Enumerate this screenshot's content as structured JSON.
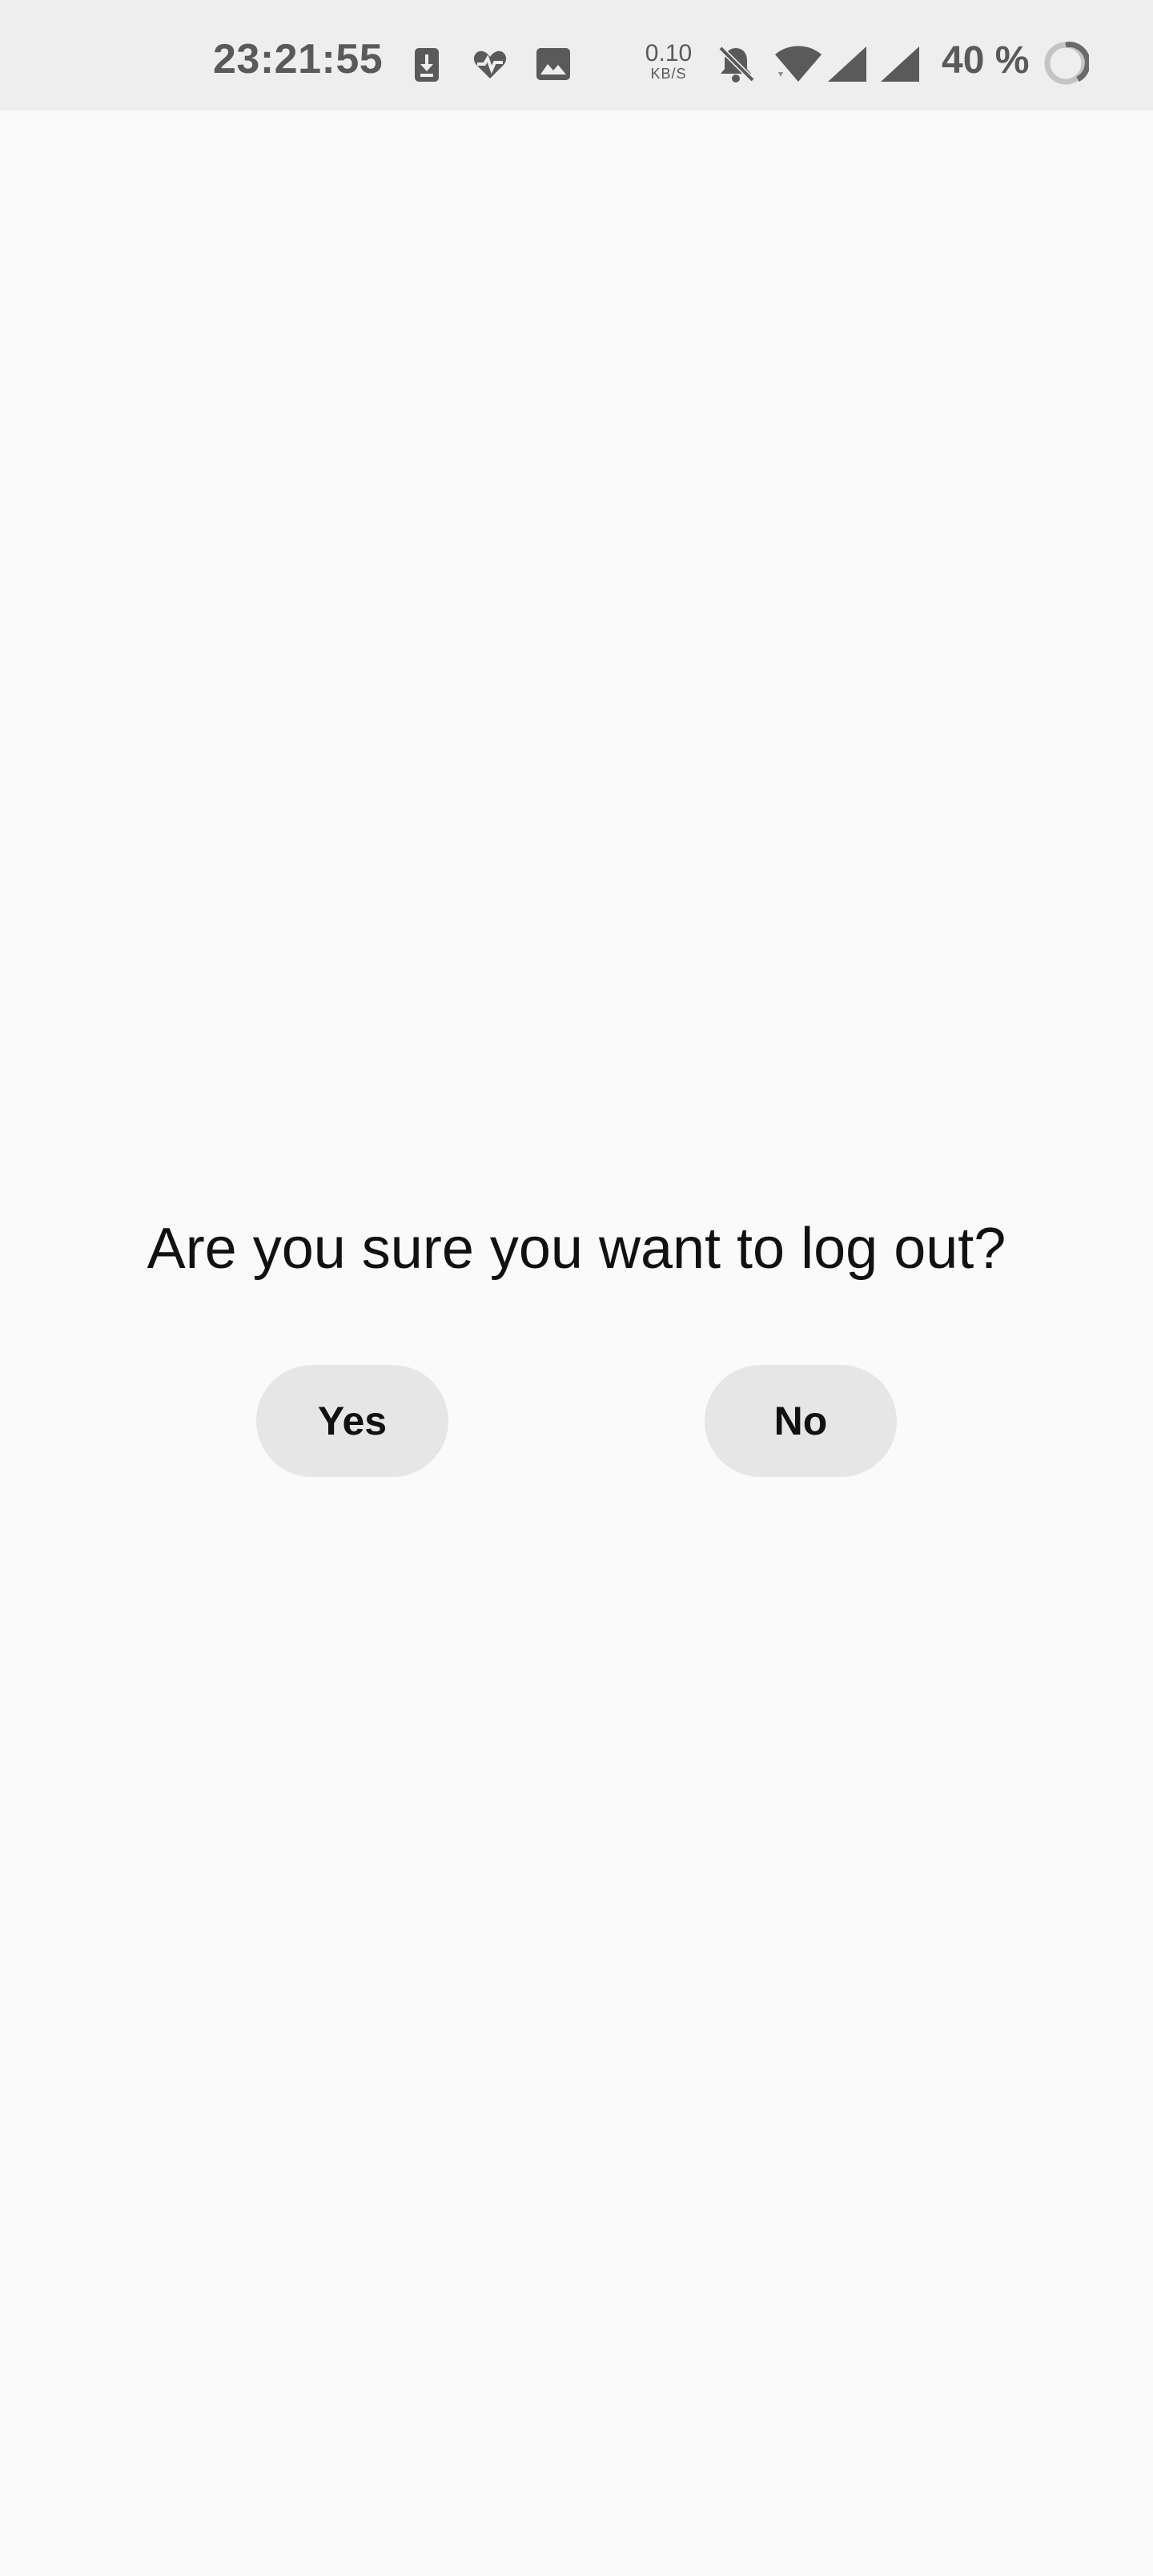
{
  "status_bar": {
    "time": "23:21:55",
    "net_speed_value": "0.10",
    "net_speed_unit": "KB/S",
    "battery_percent": "40 %",
    "icons": [
      "download-icon",
      "health-icon",
      "image-icon",
      "bell-off-icon",
      "wifi-icon",
      "signal-icon",
      "signal-icon",
      "battery-ring-icon"
    ],
    "text_color": "#5a5a5a",
    "background": "#eeeeee"
  },
  "dialog": {
    "message": "Are you sure you want to log out?",
    "yes_label": "Yes",
    "no_label": "No",
    "button_color": "#e6e6e6"
  },
  "page": {
    "background": "#fafafa"
  }
}
